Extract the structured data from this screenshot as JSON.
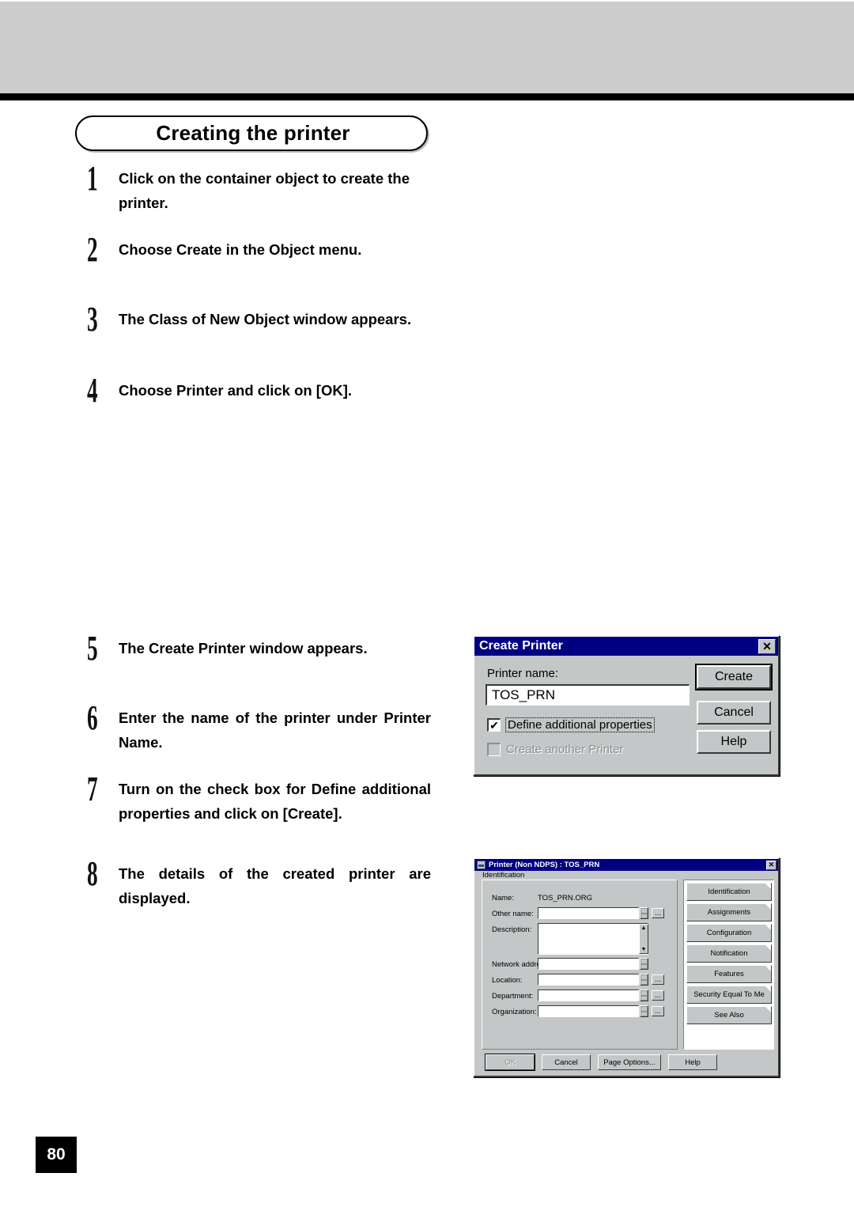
{
  "page": {
    "section_title": "Creating the printer",
    "page_number": "80",
    "accent_titlebar": "#000082",
    "dialog_face": "#c3c7c7",
    "header_band": "#cccccc"
  },
  "steps": [
    {
      "num": "1",
      "text": "Click on the container object to create the printer."
    },
    {
      "num": "2",
      "text": "Choose Create in the Object menu."
    },
    {
      "num": "3",
      "text": "The Class of New Object window appears."
    },
    {
      "num": "4",
      "text": "Choose Printer and click on [OK]."
    },
    {
      "num": "5",
      "text": "The Create Printer window appears."
    },
    {
      "num": "6",
      "text": "Enter the name of the printer under Printer Name."
    },
    {
      "num": "7",
      "text": "Turn on the check box for Define additional properties and click on [Create]."
    },
    {
      "num": "8",
      "text": "The details of the created printer are displayed."
    }
  ],
  "create_printer_dialog": {
    "title": "Create Printer",
    "close_glyph": "✕",
    "printer_name_label": "Printer name:",
    "printer_name_value": "TOS_PRN",
    "checkboxes": [
      {
        "label": "Define additional properties",
        "checked": true,
        "enabled": true,
        "check_glyph": "✔"
      },
      {
        "label": "Create another Printer",
        "checked": false,
        "enabled": false,
        "check_glyph": ""
      }
    ],
    "buttons": [
      {
        "label": "Create",
        "default": true
      },
      {
        "label": "Cancel",
        "default": false
      },
      {
        "label": "Help",
        "default": false
      }
    ]
  },
  "printer_details_dialog": {
    "title": "Printer (Non NDPS) : TOS_PRN",
    "close_glyph": "✕",
    "group_label": "Identification",
    "fields": [
      {
        "label": "Name:",
        "value": "TOS_PRN.ORG",
        "type": "static"
      },
      {
        "label": "Other name:",
        "value": "",
        "type": "text-spin-browse"
      },
      {
        "label": "Description:",
        "value": "",
        "type": "textarea"
      },
      {
        "label": "Network address:",
        "value": "",
        "type": "text-spin"
      },
      {
        "label": "Location:",
        "value": "",
        "type": "text-spin-browse"
      },
      {
        "label": "Department:",
        "value": "",
        "type": "text-spin-browse"
      },
      {
        "label": "Organization:",
        "value": "",
        "type": "text-spin-browse"
      }
    ],
    "browse_label": "...",
    "tabs": [
      {
        "label": "Identification"
      },
      {
        "label": "Assignments"
      },
      {
        "label": "Configuration"
      },
      {
        "label": "Notification"
      },
      {
        "label": "Features"
      },
      {
        "label": "Security Equal To Me"
      },
      {
        "label": "See Also"
      }
    ],
    "buttons": [
      {
        "label": "OK",
        "enabled": false,
        "default": true
      },
      {
        "label": "Cancel",
        "enabled": true,
        "default": false
      },
      {
        "label": "Page Options...",
        "enabled": true,
        "default": false
      },
      {
        "label": "Help",
        "enabled": true,
        "default": false
      }
    ]
  }
}
